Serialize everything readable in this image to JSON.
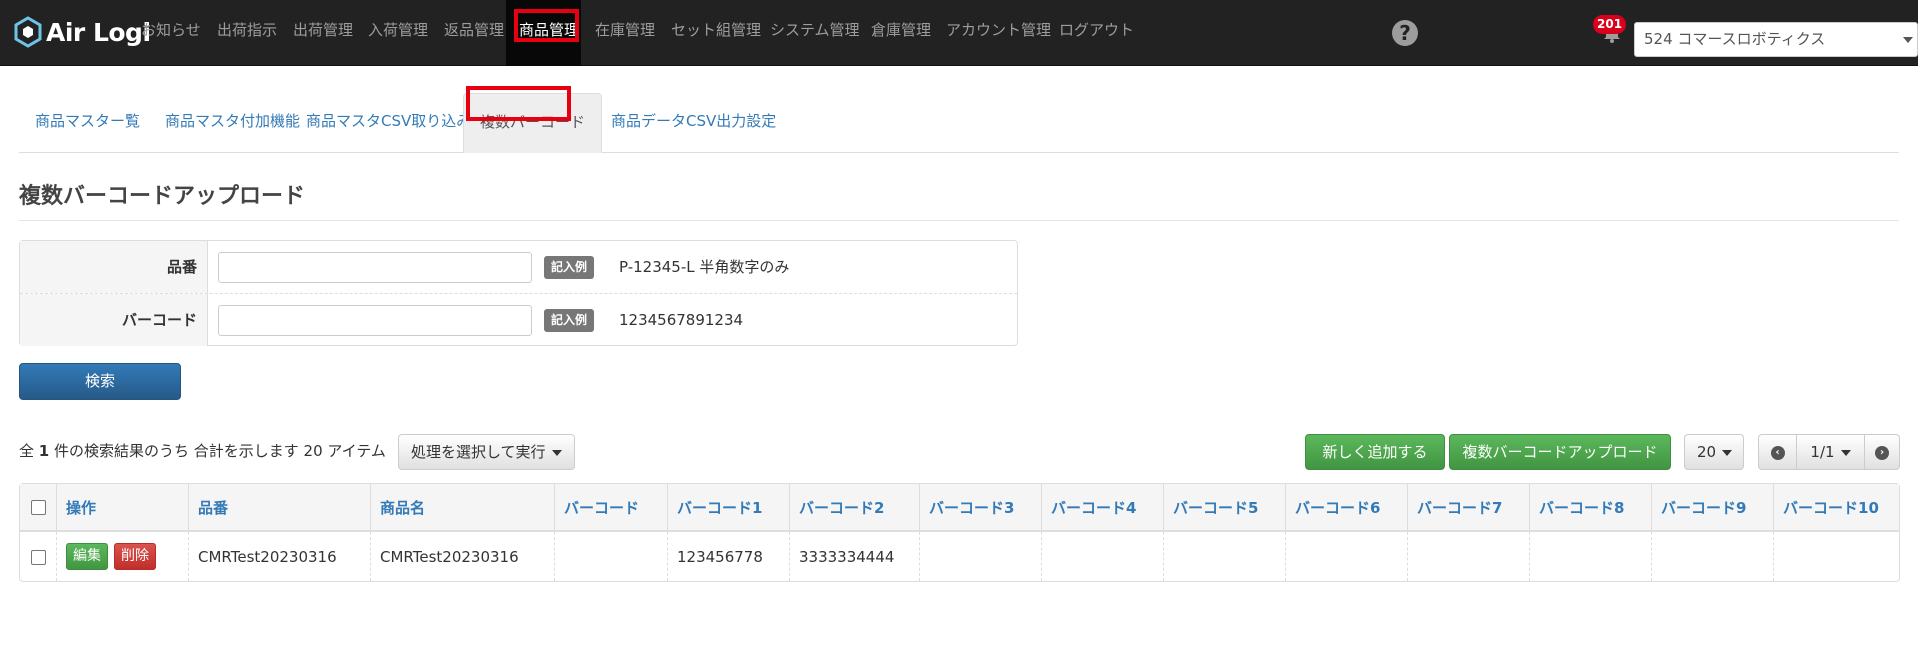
{
  "app": {
    "logo_text": "Air Logi"
  },
  "nav": {
    "items": [
      "お知らせ",
      "出荷指示",
      "出荷管理",
      "入荷管理",
      "返品管理",
      "商品管理",
      "在庫管理",
      "セット組管理",
      "システム管理",
      "倉庫管理",
      "アカウント管理",
      "ログアウト"
    ],
    "active": "商品管理",
    "help_icon": "question-circle-icon",
    "notification_count": "201",
    "company_select": "524 コマースロボティクス"
  },
  "subtabs": {
    "items": [
      "商品マスター覧",
      "商品マスタ付加機能",
      "商品マスタCSV取り込み設定",
      "複数バーコード",
      "商品データCSV出力設定"
    ],
    "active": "複数バーコード"
  },
  "page": {
    "title": "複数バーコードアップロード"
  },
  "search": {
    "rows": [
      {
        "label": "品番",
        "value": "",
        "example_badge": "記入例",
        "example_text": "P-12345-L 半角数字のみ"
      },
      {
        "label": "バーコード",
        "value": "",
        "example_badge": "記入例",
        "example_text": "1234567891234"
      }
    ],
    "button": "検索"
  },
  "results": {
    "prefix": "全",
    "count": "1",
    "suffix": "件の検索結果のうち 合計を示します 20 アイテム",
    "action_dropdown": "処理を選択して実行",
    "add_button": "新しく追加する",
    "upload_button": "複数バーコードアップロード",
    "per_page": "20",
    "page": "1/1"
  },
  "table": {
    "headers": [
      "操作",
      "品番",
      "商品名",
      "バーコード",
      "バーコード1",
      "バーコード2",
      "バーコード3",
      "バーコード4",
      "バーコード5",
      "バーコード6",
      "バーコード7",
      "バーコード8",
      "バーコード9",
      "バーコード10"
    ],
    "row_buttons": {
      "edit": "編集",
      "delete": "削除"
    },
    "rows": [
      {
        "item_code": "CMRTest20230316",
        "item_name": "CMRTest20230316",
        "barcode": "",
        "barcode1": "123456778",
        "barcode2": "3333334444",
        "barcode3": "",
        "barcode4": "",
        "barcode5": "",
        "barcode6": "",
        "barcode7": "",
        "barcode8": "",
        "barcode9": "",
        "barcode10": ""
      }
    ]
  },
  "colors": {
    "highlight_box": "#e60012",
    "nav_bg": "#222222",
    "link": "#337ab7"
  }
}
